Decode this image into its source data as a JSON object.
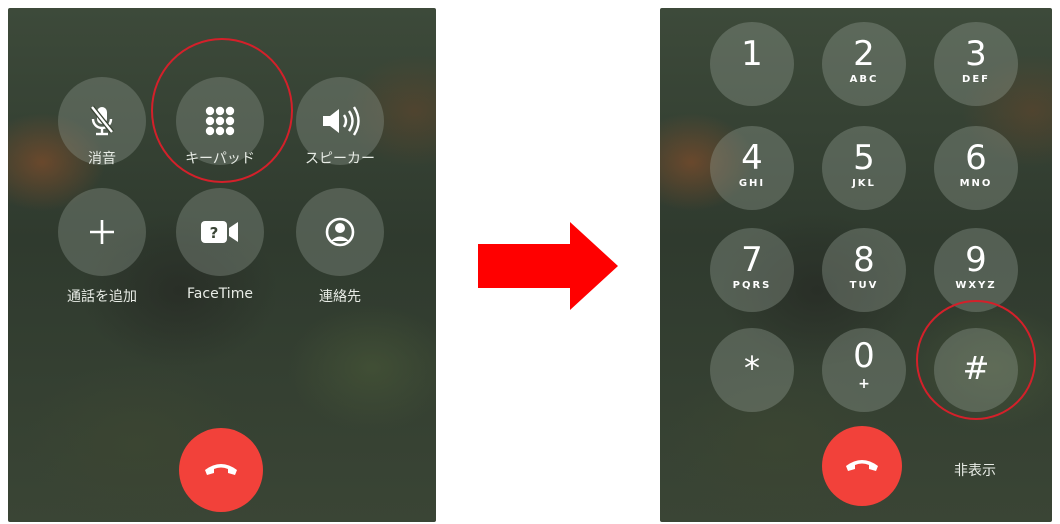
{
  "left_screen": {
    "controls": [
      {
        "label": "消音",
        "icon": "mute-mic-icon"
      },
      {
        "label": "キーパッド",
        "icon": "keypad-grid-icon"
      },
      {
        "label": "スピーカー",
        "icon": "speaker-icon"
      },
      {
        "label": "通話を追加",
        "icon": "plus-icon"
      },
      {
        "label": "FaceTime",
        "icon": "facetime-icon"
      },
      {
        "label": "連絡先",
        "icon": "contacts-icon"
      }
    ],
    "highlighted_control": "キーパッド",
    "end_call_icon": "end-call-icon"
  },
  "right_screen": {
    "keys": [
      {
        "digit": "1",
        "letters": ""
      },
      {
        "digit": "2",
        "letters": "ABC"
      },
      {
        "digit": "3",
        "letters": "DEF"
      },
      {
        "digit": "4",
        "letters": "GHI"
      },
      {
        "digit": "5",
        "letters": "JKL"
      },
      {
        "digit": "6",
        "letters": "MNO"
      },
      {
        "digit": "7",
        "letters": "PQRS"
      },
      {
        "digit": "8",
        "letters": "TUV"
      },
      {
        "digit": "9",
        "letters": "WXYZ"
      },
      {
        "digit": "*",
        "letters": ""
      },
      {
        "digit": "0",
        "letters": "+"
      },
      {
        "digit": "#",
        "letters": ""
      }
    ],
    "highlighted_key": "#",
    "hide_label": "非表示",
    "end_call_icon": "end-call-icon"
  },
  "colors": {
    "highlight_ring": "#d4202a",
    "arrow": "#ff0000",
    "end_call": "#f2413a"
  }
}
